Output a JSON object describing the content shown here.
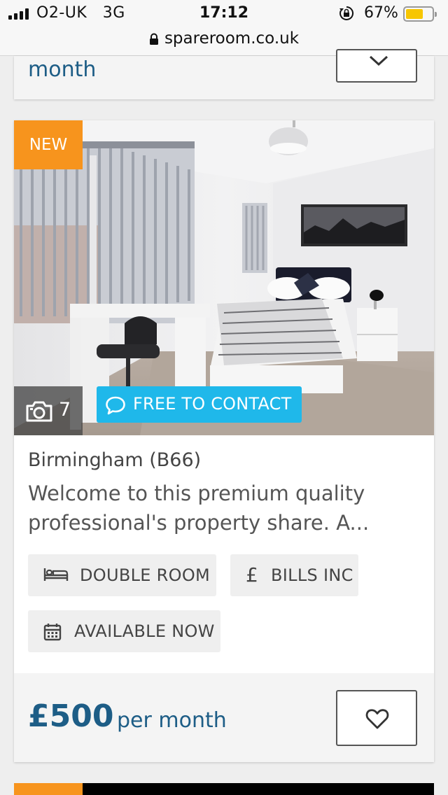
{
  "status_bar": {
    "carrier": "O2-UK   3G",
    "time": "17:12",
    "battery_percent": "67%",
    "battery_level": 0.67
  },
  "url_bar": {
    "url": "spareroom.co.uk"
  },
  "previous_listing": {
    "price_suffix": "month"
  },
  "listing": {
    "badge": "NEW",
    "photo_count": "7",
    "contact_button": "FREE TO CONTACT",
    "location": "Birmingham (B66)",
    "description": "Welcome to this premium quality professional's property share. A...",
    "tags": {
      "room_type": "DOUBLE ROOM",
      "bills": "BILLS INC",
      "availability": "AVAILABLE NOW"
    },
    "price": "£500",
    "price_suffix": "per month"
  },
  "colors": {
    "brand_blue": "#1d5d86",
    "badge_orange": "#f7941d",
    "contact_cyan": "#1fb8ea"
  },
  "icons": {
    "signal": "signal-bars-icon",
    "rotation_lock": "rotation-lock-icon",
    "battery": "battery-icon",
    "padlock": "padlock-icon",
    "camera": "camera-icon",
    "chat": "chat-bubble-icon",
    "bed": "bed-icon",
    "pound": "pound-icon",
    "calendar": "calendar-icon",
    "heart": "heart-icon",
    "chevron": "chevron-down-icon"
  }
}
